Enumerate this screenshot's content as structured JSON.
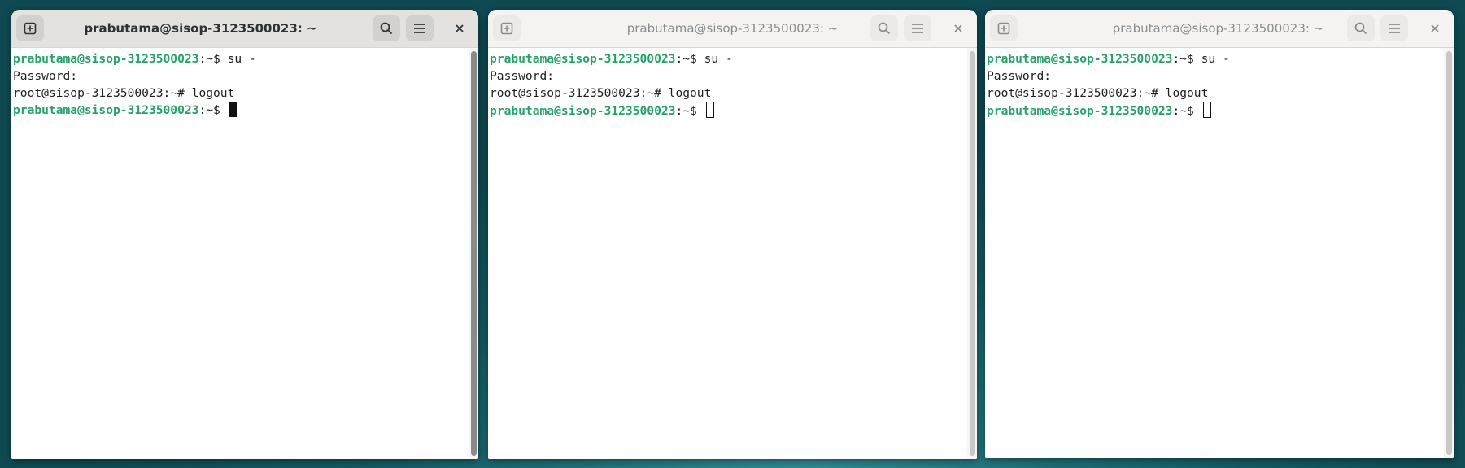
{
  "windows": [
    {
      "title": "prabutama@sisop-3123500023: ~",
      "state": "active",
      "lines": [
        {
          "user": "prabutama@sisop-3123500023",
          "sep": ":~$ ",
          "text": "su -"
        },
        {
          "text": "Password:"
        },
        {
          "text": "root@sisop-3123500023:~# logout"
        },
        {
          "user": "prabutama@sisop-3123500023",
          "sep": ":~$ ",
          "text": ""
        }
      ]
    },
    {
      "title": "prabutama@sisop-3123500023: ~",
      "state": "inactive",
      "lines": [
        {
          "user": "prabutama@sisop-3123500023",
          "sep": ":~$ ",
          "text": "su -"
        },
        {
          "text": "Password:"
        },
        {
          "text": "root@sisop-3123500023:~# logout"
        },
        {
          "user": "prabutama@sisop-3123500023",
          "sep": ":~$ ",
          "text": ""
        }
      ]
    },
    {
      "title": "prabutama@sisop-3123500023: ~",
      "state": "inactive",
      "lines": [
        {
          "user": "prabutama@sisop-3123500023",
          "sep": ":~$ ",
          "text": "su -"
        },
        {
          "text": "Password:"
        },
        {
          "text": "root@sisop-3123500023:~# logout"
        },
        {
          "user": "prabutama@sisop-3123500023",
          "sep": ":~$ ",
          "text": ""
        }
      ]
    }
  ],
  "icons": {
    "new_tab": "new-tab-icon",
    "search": "search-icon",
    "menu": "hamburger-menu-icon",
    "close": "close-icon"
  },
  "colors": {
    "prompt_user": "#26a269",
    "desktop": "#155a62"
  }
}
